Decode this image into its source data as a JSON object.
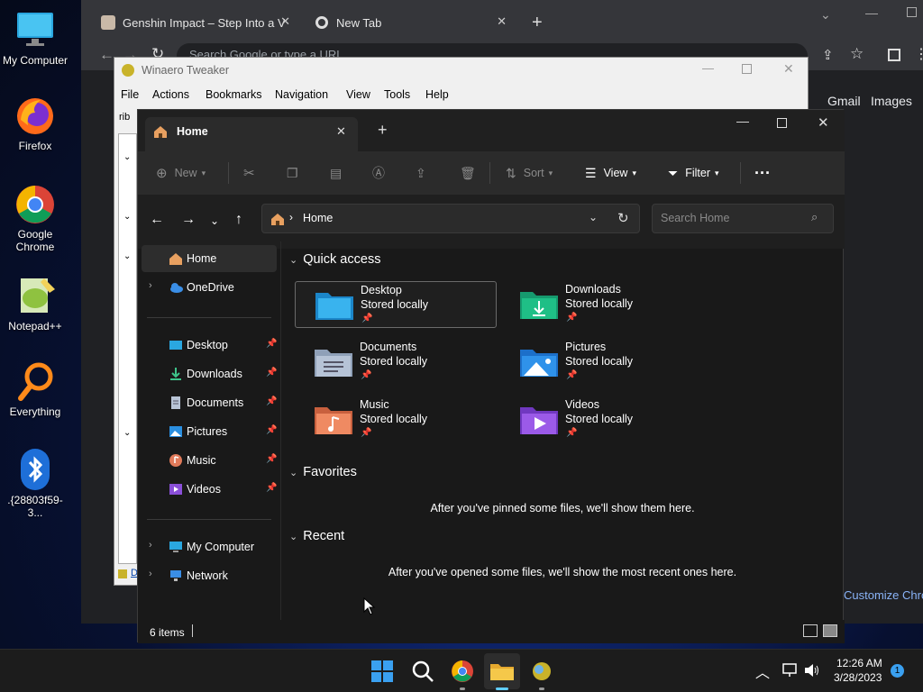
{
  "desktop": {
    "icons": [
      {
        "label": "My Computer",
        "icon": "monitor-icon"
      },
      {
        "label": "Firefox",
        "icon": "firefox-icon"
      },
      {
        "label": "Google Chrome",
        "icon": "chrome-icon"
      },
      {
        "label": "Notepad++",
        "icon": "notepad-plus-plus-icon"
      },
      {
        "label": "Everything",
        "icon": "magnifier-icon"
      },
      {
        "label": ".{28803f59-3...",
        "icon": "bluetooth-icon"
      }
    ]
  },
  "chrome": {
    "tabs": [
      {
        "title": "Genshin Impact – Step Into a Vas"
      },
      {
        "title": "New Tab"
      }
    ],
    "omnibox_placeholder": "Search Google or type a URL",
    "links": [
      "Gmail",
      "Images"
    ],
    "customize": "Customize Chro"
  },
  "winaero": {
    "title": "Winaero Tweaker",
    "menu": [
      "File",
      "Actions",
      "Bookmarks",
      "Navigation",
      "View",
      "Tools",
      "Help"
    ],
    "search_fragment": "rib",
    "footer_fragment": "D"
  },
  "explorer": {
    "tab_title": "Home",
    "toolbar": {
      "new": "New",
      "sort": "Sort",
      "view": "View",
      "filter": "Filter"
    },
    "address": {
      "crumb": "Home"
    },
    "search_placeholder": "Search Home",
    "sidebar": {
      "home": "Home",
      "onedrive": "OneDrive",
      "pinned": [
        "Desktop",
        "Downloads",
        "Documents",
        "Pictures",
        "Music",
        "Videos"
      ],
      "my_computer": "My Computer",
      "network": "Network"
    },
    "sections": {
      "quick_access": "Quick access",
      "favorites": "Favorites",
      "recent": "Recent"
    },
    "quick_access": [
      {
        "name": "Desktop",
        "status": "Stored locally"
      },
      {
        "name": "Downloads",
        "status": "Stored locally"
      },
      {
        "name": "Documents",
        "status": "Stored locally"
      },
      {
        "name": "Pictures",
        "status": "Stored locally"
      },
      {
        "name": "Music",
        "status": "Stored locally"
      },
      {
        "name": "Videos",
        "status": "Stored locally"
      }
    ],
    "favorites_empty": "After you've pinned some files, we'll show them here.",
    "recent_empty": "After you've opened some files, we'll show the most recent ones here.",
    "status": {
      "items": "6 items"
    }
  },
  "taskbar": {
    "time": "12:26 AM",
    "date": "3/28/2023",
    "notification_count": "1"
  },
  "colors": {
    "accent": "#0078d4",
    "folder_yellow": "#f2c14e"
  }
}
